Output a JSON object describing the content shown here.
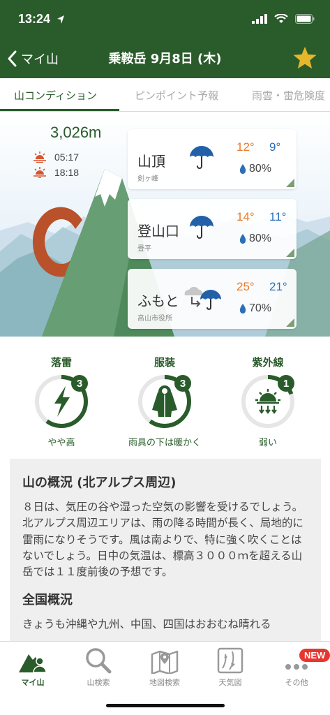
{
  "status_bar": {
    "time": "13:24"
  },
  "nav": {
    "back_label": "マイ山",
    "title": "乗鞍岳  9月8日 (木)"
  },
  "tabs": [
    {
      "label": "山コンディション",
      "active": true
    },
    {
      "label": "ピンポイント予報",
      "active": false
    },
    {
      "label": "雨雲・雷危険度",
      "active": false
    }
  ],
  "mountain": {
    "altitude": "3,026m",
    "sunrise": "05:17",
    "sunset": "18:18"
  },
  "forecast": [
    {
      "name": "山頂",
      "sub": "剣ヶ峰",
      "icon": "umbrella-icon",
      "high": "12°",
      "low": "9°",
      "precip": "80%"
    },
    {
      "name": "登山口",
      "sub": "畳平",
      "icon": "umbrella-icon",
      "high": "14°",
      "low": "11°",
      "precip": "80%"
    },
    {
      "name": "ふもと",
      "sub": "高山市役所",
      "icon": "cloud-to-rain-icon",
      "high": "25°",
      "low": "21°",
      "precip": "70%"
    }
  ],
  "indicators": [
    {
      "label": "落雷",
      "level": "3",
      "max_level": 5,
      "desc": "やや高",
      "icon": "lightning-icon"
    },
    {
      "label": "服装",
      "level": "3",
      "max_level": 5,
      "desc": "雨具の下は暖かく",
      "icon": "raincoat-icon"
    },
    {
      "label": "紫外線",
      "level": "1",
      "max_level": 5,
      "desc": "弱い",
      "icon": "uv-icon"
    }
  ],
  "overview": {
    "title": "山の概況 (北アルプス周辺)",
    "body": "８日は、気圧の谷や湿った空気の影響を受けるでしょう。北アルプス周辺エリアは、雨の降る時間が長く、局地的に雷雨になりそうです。風は南よりで、特に強く吹くことはないでしょう。日中の気温は、標高３０００ｍを超える山岳では１１度前後の予想です。",
    "national_title": "全国概況",
    "national_body": "きょうも沖縄や九州、中国、四国はおおむね晴れる"
  },
  "bottom_nav": [
    {
      "label": "マイ山",
      "icon": "my-mountain-icon",
      "active": true
    },
    {
      "label": "山検索",
      "icon": "search-icon",
      "active": false
    },
    {
      "label": "地図検索",
      "icon": "map-icon",
      "active": false
    },
    {
      "label": "天気図",
      "icon": "weather-map-icon",
      "active": false
    },
    {
      "label": "その他",
      "icon": "more-icon",
      "active": false,
      "badge": "NEW"
    }
  ],
  "colors": {
    "brand": "#2a5b2b",
    "high_temp": "#e87b2c",
    "low_temp": "#2c6fb8",
    "star": "#e6b62c",
    "badge": "#e5362f"
  }
}
